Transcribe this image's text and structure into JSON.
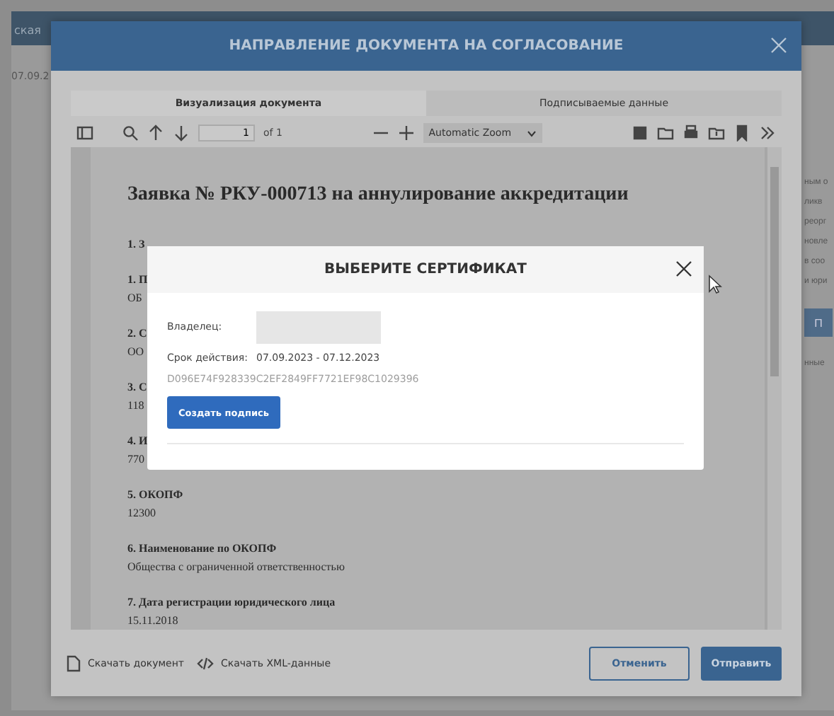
{
  "background": {
    "header_fragment": "ская",
    "date_fragment": "07.09.2",
    "side_fragments": [
      {
        "kind": "text",
        "text": "ным о"
      },
      {
        "kind": "text",
        "text": "ликв"
      },
      {
        "kind": "text",
        "text": "реорг"
      },
      {
        "kind": "text",
        "text": "новле"
      },
      {
        "kind": "text",
        "text": "в соо"
      },
      {
        "kind": "text",
        "text": "и юри"
      },
      {
        "kind": "button",
        "text": "П"
      },
      {
        "kind": "text",
        "text": "нные"
      }
    ]
  },
  "dialog": {
    "title": "НАПРАВЛЕНИЕ ДОКУМЕНТА НА СОГЛАСОВАНИЕ",
    "tabs": [
      {
        "label": "Визуализация документа",
        "selected": true
      },
      {
        "label": "Подписываемые данные",
        "selected": false
      }
    ],
    "viewer": {
      "page_number": "1",
      "page_count": "of 1",
      "zoom": "Automatic Zoom",
      "document": {
        "title": "Заявка № РКУ-000713 на аннулирование аккредитации",
        "items": [
          {
            "label": "1. З"
          },
          {
            "label": "1. П",
            "value": "ОБ"
          },
          {
            "label": "2. С",
            "value": "ОО"
          },
          {
            "label": "3. С",
            "value": "118"
          },
          {
            "label": "4. И",
            "value": "770"
          },
          {
            "label": "5. ОКОПФ",
            "value": "12300"
          },
          {
            "label": "6. Наименование по ОКОПФ",
            "value": "Общества с ограниченной ответственностью"
          },
          {
            "label": "7. Дата регистрации юридического лица",
            "value": "15.11.2018"
          }
        ]
      }
    },
    "footer": {
      "links": [
        {
          "kind": "document",
          "label": "Скачать документ"
        },
        {
          "kind": "code",
          "label": "Скачать XML-данные"
        }
      ],
      "cancel": "Отменить",
      "submit": "Отправить"
    }
  },
  "certificate_modal": {
    "title": "ВЫБЕРИТЕ СЕРТИФИКАТ",
    "owner_label": "Владелец:",
    "validity_label": "Срок действия:",
    "validity": "07.09.2023 - 07.12.2023",
    "thumbprint": "D096E74F928339C2EF2849FF7721EF98C1029396",
    "button": "Создать подпись"
  }
}
